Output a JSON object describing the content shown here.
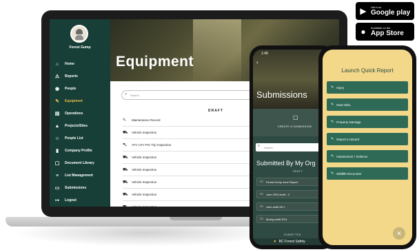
{
  "badges": {
    "google": {
      "small": "Get it on",
      "large": "Google play"
    },
    "apple": {
      "small": "Available on the",
      "large": "App Store"
    }
  },
  "laptop": {
    "sidebar": {
      "user_name": "Forest Gump",
      "items": [
        {
          "label": "Home",
          "icon": "home-icon",
          "glyph": "⌂"
        },
        {
          "label": "Reports",
          "icon": "warning-icon",
          "glyph": "⚠"
        },
        {
          "label": "People",
          "icon": "eye-icon",
          "glyph": "◉"
        },
        {
          "label": "Equipment",
          "icon": "wrench-icon",
          "glyph": "✎",
          "active": true
        },
        {
          "label": "Operations",
          "icon": "document-icon",
          "glyph": "▤"
        },
        {
          "label": "Projects/Sites",
          "icon": "mountain-icon",
          "glyph": "▲"
        },
        {
          "label": "People List",
          "icon": "user-icon",
          "glyph": "☺"
        },
        {
          "label": "Company Profile",
          "icon": "bookmark-icon",
          "glyph": "▮"
        },
        {
          "label": "Document Library",
          "icon": "doc-icon",
          "glyph": "▢"
        },
        {
          "label": "List Management",
          "icon": "list-icon",
          "glyph": "≡"
        },
        {
          "label": "Submissions",
          "icon": "folder-icon",
          "glyph": "▭"
        },
        {
          "label": "Logout",
          "icon": "logout-icon",
          "glyph": "↦"
        }
      ]
    },
    "main": {
      "title": "Equipment",
      "search_placeholder": "Search",
      "section_label": "DRAFT",
      "rows": [
        {
          "label": "Maintenance Record",
          "icon": "wrench-icon",
          "glyph": "✎"
        },
        {
          "label": "Vehicle Inspection",
          "icon": "truck-icon",
          "glyph": "⛟"
        },
        {
          "label": "ATV UTV Pre Trip Inspection",
          "icon": "atv-icon",
          "glyph": "⛍"
        },
        {
          "label": "Vehicle Inspection",
          "icon": "truck-icon",
          "glyph": "⛟"
        },
        {
          "label": "Vehicle Inspection",
          "icon": "truck-icon",
          "glyph": "⛟"
        },
        {
          "label": "Vehicle Inspection",
          "icon": "truck-icon",
          "glyph": "⛟"
        },
        {
          "label": "Vehicle Inspection",
          "icon": "truck-icon",
          "glyph": "⛟"
        },
        {
          "label": "Vehicle Inspection",
          "icon": "truck-icon",
          "glyph": "⛟"
        }
      ]
    }
  },
  "phone1": {
    "time": "1:48",
    "title": "Submissions",
    "create_label": "CREATE A SUBMISSION",
    "search_placeholder": "Search",
    "heading": "Submitted By My Org",
    "draft_label": "DRAFT",
    "rows": [
      "Forest Gump June Report",
      "June 2024 Audit - 2",
      "June audit 28-1",
      "Spring audit 2011"
    ],
    "submitted_label": "SUBMITTED",
    "footer": "BC Forest Safety"
  },
  "phone2": {
    "title": "Launch Quick Report",
    "items": [
      "Injury",
      "Near Miss",
      "Property Damage",
      "Report a Hazard",
      "Harassment / Violence",
      "Wildlife Encounter"
    ],
    "close_glyph": "✕"
  },
  "colors": {
    "sidebar": "#173f37",
    "accent": "#e8b94a",
    "quick_report_bg": "#f3d88a",
    "quick_report_item": "#2f6a57"
  }
}
